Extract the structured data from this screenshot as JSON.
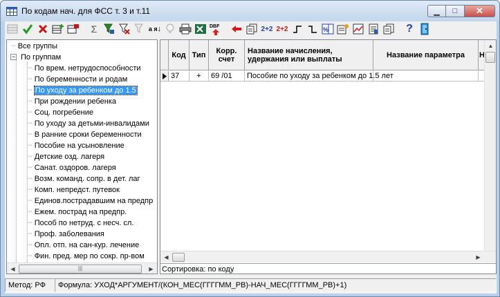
{
  "window": {
    "title": "По кодам нач. для ФСС т. 3 и т.11",
    "icon": "table-app-icon",
    "controls": [
      "minimize-icon",
      "maximize-icon",
      "close-icon"
    ]
  },
  "toolbar": {
    "buttons": [
      {
        "icon": "grid-view-icon",
        "enabled": false
      },
      {
        "icon": "check-icon",
        "color": "#1e9a1e"
      },
      {
        "icon": "delete-x-icon",
        "color": "#c81414"
      },
      {
        "icon": "add-record-icon"
      },
      {
        "icon": "copy-record-icon"
      },
      {
        "icon": "sum-icon",
        "label": "Σ"
      },
      {
        "icon": "filter-icon"
      },
      {
        "icon": "clear-filter-icon"
      },
      {
        "icon": "filter-disabled-icon",
        "enabled": false
      },
      {
        "icon": "sort-az-icon",
        "label": "а я"
      },
      {
        "icon": "lightbulb-icon",
        "enabled": false
      },
      {
        "icon": "print-icon"
      },
      {
        "icon": "excel-icon"
      },
      {
        "icon": "dbf-export-icon",
        "label": "DBF"
      },
      {
        "icon": "arrow-left-icon"
      },
      {
        "icon": "copy-pages-icon"
      },
      {
        "icon": "formula-blue-icon",
        "label": "2+2"
      },
      {
        "icon": "formula-red-icon",
        "label": "2+2"
      },
      {
        "icon": "step-up-icon"
      },
      {
        "icon": "step-down-icon"
      },
      {
        "icon": "percent-table-icon"
      },
      {
        "icon": "properties-icon"
      },
      {
        "icon": "chart-icon"
      },
      {
        "icon": "report-icon"
      },
      {
        "icon": "notes-icon"
      },
      {
        "icon": "help-icon",
        "label": "?"
      },
      {
        "icon": "exit-door-icon"
      }
    ]
  },
  "tree": {
    "root_all": "Все группы",
    "root_groups": "По группам",
    "items": [
      "По врем. нетрудоспособности",
      "По беременности и родам",
      "По уходу за ребенком до 1.5",
      "При рождении ребенка",
      "Соц. погребение",
      "По уходу за детьми-инвалидами",
      "В ранние сроки беременности",
      "Пособие на усыновление",
      "Детские озд. лагеря",
      "Санат. оздоров. лагеря",
      "Возм. команд. сопр. в дет. лаг",
      "Комп. непредст. путевок",
      "Единов.пострадавшим на предпр",
      "Ежем. пострад на предпр.",
      "Пособ по нетруд. с несч. сл.",
      "Проф. заболевания",
      "Опл. отп. на  сан-кур. лечение",
      "Фин. пред. мер по сокр. пр-вом"
    ],
    "selected_index": 2
  },
  "grid": {
    "columns": [
      "Код",
      "Тип",
      "Корр. счет",
      "Название начисления, удержания или выплаты",
      "Название параметра",
      "Н"
    ],
    "rows": [
      {
        "code": "37",
        "type": "+",
        "account": "69 /01",
        "name": "Пособие по уходу за ребенком до 1.5 лет",
        "param": ""
      }
    ]
  },
  "sort_label": "Сортировка: по коду",
  "status": {
    "method": "Метод:  РФ",
    "formula": "Формула:  УХОД*АРГУМЕНТ/(КОН_МЕС(ГГГГММ_РВ)-НАЧ_МЕС(ГГГГММ_РВ)+1)"
  }
}
